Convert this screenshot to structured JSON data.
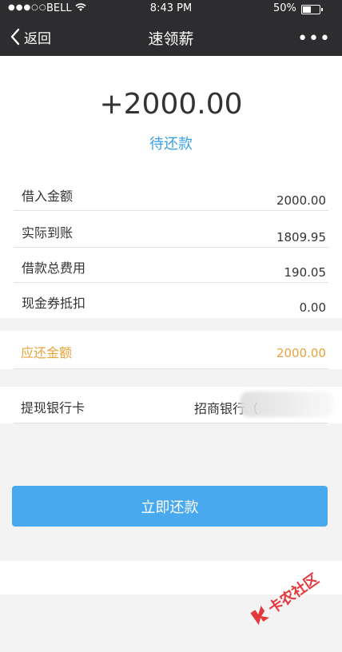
{
  "status_bar": {
    "carrier": "BELL",
    "time": "8:43 PM",
    "battery": "50%",
    "signal_dots": "●●●○○"
  },
  "nav": {
    "back_label": "返回",
    "title": "速领薪",
    "more": "•••"
  },
  "summary": {
    "amount": "+2000.00",
    "status": "待还款"
  },
  "details": [
    {
      "label": "借入金额",
      "value": "2000.00"
    },
    {
      "label": "实际到账",
      "value": "1809.95"
    },
    {
      "label": "借款总费用",
      "value": "190.05"
    },
    {
      "label": "现金券抵扣",
      "value": "0.00"
    }
  ],
  "due": {
    "label": "应还金额",
    "value": "2000.00"
  },
  "bank": {
    "label": "提现银行卡",
    "value": "招商银行（"
  },
  "actions": {
    "repay_label": "立即还款"
  },
  "watermark": {
    "text": "卡农社区"
  },
  "colors": {
    "accent": "#3aa0e2",
    "due": "#e8a33a",
    "button": "#49a9ee",
    "nav_bg": "#2d2d2f"
  }
}
